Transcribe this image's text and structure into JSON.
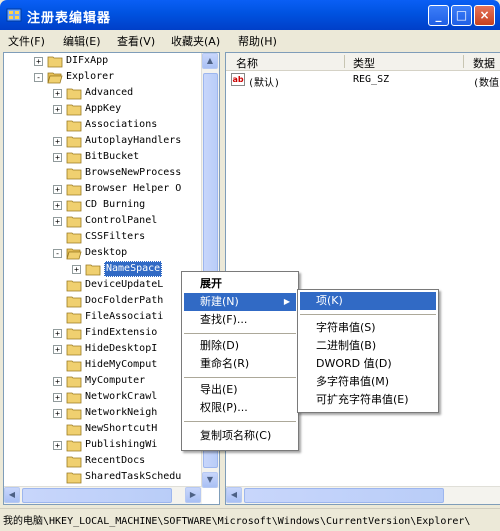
{
  "window": {
    "title": "注册表编辑器",
    "buttons": {
      "minimize": "_",
      "maximize": "□",
      "close": "×"
    }
  },
  "menubar": [
    "文件(F)",
    "编辑(E)",
    "查看(V)",
    "收藏夹(A)",
    "帮助(H)"
  ],
  "tree": {
    "items": [
      {
        "label": "DIFxApp",
        "expander": "+"
      },
      {
        "label": "Explorer",
        "expander": "−"
      },
      {
        "label": "Advanced",
        "expander": "+"
      },
      {
        "label": "AppKey",
        "expander": "+"
      },
      {
        "label": "Associations",
        "expander": ""
      },
      {
        "label": "AutoplayHandlers",
        "expander": "+"
      },
      {
        "label": "BitBucket",
        "expander": "+"
      },
      {
        "label": "BrowseNewProcess",
        "expander": ""
      },
      {
        "label": "Browser Helper O",
        "expander": "+"
      },
      {
        "label": "CD Burning",
        "expander": "+"
      },
      {
        "label": "ControlPanel",
        "expander": "+"
      },
      {
        "label": "CSSFilters",
        "expander": ""
      },
      {
        "label": "Desktop",
        "expander": "−"
      },
      {
        "label": "NameSpace",
        "expander": "+"
      },
      {
        "label": "DeviceUpdateL",
        "expander": ""
      },
      {
        "label": "DocFolderPath",
        "expander": ""
      },
      {
        "label": "FileAssociati",
        "expander": ""
      },
      {
        "label": "FindExtensio",
        "expander": "+"
      },
      {
        "label": "HideDesktopI",
        "expander": "+"
      },
      {
        "label": "HideMyComput",
        "expander": ""
      },
      {
        "label": "MyComputer",
        "expander": "+"
      },
      {
        "label": "NetworkCrawl",
        "expander": "+"
      },
      {
        "label": "NetworkNeigh",
        "expander": "+"
      },
      {
        "label": "NewShortcutH",
        "expander": ""
      },
      {
        "label": "PublishingWi",
        "expander": "+"
      },
      {
        "label": "RecentDocs",
        "expander": ""
      },
      {
        "label": "SharedTaskSchedu",
        "expander": ""
      }
    ]
  },
  "list": {
    "columns": [
      "名称",
      "类型",
      "数据"
    ],
    "rows": [
      {
        "icon": "ab",
        "name": "(默认)",
        "type": "REG_SZ",
        "data": "(数值"
      }
    ]
  },
  "context_menu": {
    "items": [
      "展开",
      "新建(N)",
      "查找(F)...",
      "删除(D)",
      "重命名(R)",
      "导出(E)",
      "权限(P)...",
      "复制项名称(C)"
    ]
  },
  "submenu": {
    "items": [
      "项(K)",
      "字符串值(S)",
      "二进制值(B)",
      "DWORD 值(D)",
      "多字符串值(M)",
      "可扩充字符串值(E)"
    ]
  },
  "statusbar": {
    "path": "我的电脑\\HKEY_LOCAL_MACHINE\\SOFTWARE\\Microsoft\\Windows\\CurrentVersion\\Explorer\\"
  },
  "colors": {
    "titlebar": "#0054e3",
    "selection": "#316ac5",
    "folder": "#f0d070"
  }
}
